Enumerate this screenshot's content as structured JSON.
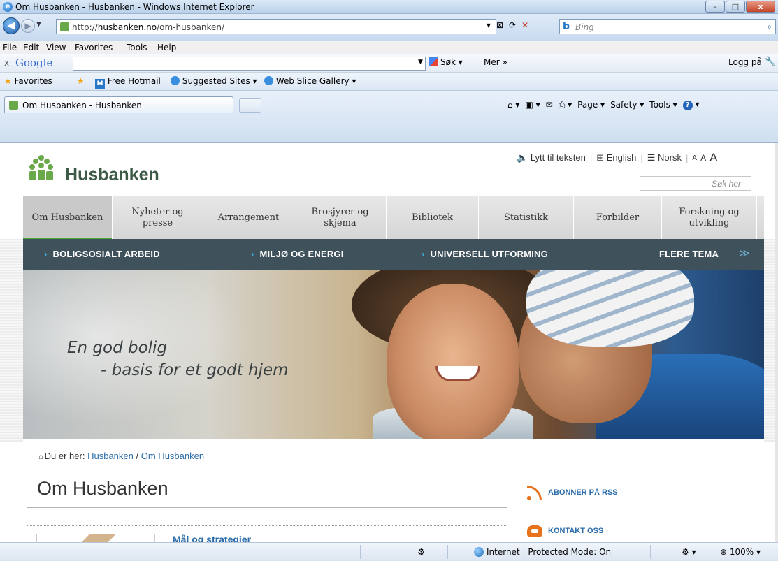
{
  "window": {
    "title": "Om Husbanken - Husbanken - Windows Internet Explorer",
    "minimize": "–",
    "maximize": "□",
    "close": "x"
  },
  "address": {
    "url_prefix": "http://",
    "url_host": "husbanken.no",
    "url_path": "/om-husbanken/",
    "search_placeholder": "Bing",
    "bing_logo": "b"
  },
  "menu": [
    "File",
    "Edit",
    "View",
    "Favorites",
    "Tools",
    "Help"
  ],
  "google_toolbar": {
    "close": "x",
    "logo": "Google",
    "search_button": "Søk",
    "more": "Mer »",
    "login": "Logg på"
  },
  "favorites_bar": {
    "favorites": "Favorites",
    "item1": "Free Hotmail",
    "item2": "Suggested Sites ▾",
    "item3": "Web Slice Gallery ▾"
  },
  "tab": {
    "title": "Om Husbanken - Husbanken"
  },
  "command_bar": {
    "page": "Page ▾",
    "safety": "Safety ▾",
    "tools": "Tools ▾"
  },
  "site": {
    "logo_text": "Husbanken",
    "util_listen": "Lytt til teksten",
    "util_english": "English",
    "util_norsk": "Norsk",
    "font_small": "A",
    "font_medium": "A",
    "font_large": "A",
    "search_placeholder": "Søk her",
    "nav": [
      {
        "label": "Om Husbanken",
        "active": true
      },
      {
        "label": "Nyheter og presse"
      },
      {
        "label": "Arrangement"
      },
      {
        "label": "Brosjyrer og skjema"
      },
      {
        "label": "Bibliotek"
      },
      {
        "label": "Statistikk"
      },
      {
        "label": "Forbilder"
      },
      {
        "label": "Forskning og utvikling"
      }
    ],
    "themes": [
      "BOLIGSOSIALT ARBEID",
      "MILJØ OG ENERGI",
      "UNIVERSELL UTFORMING",
      "FLERE TEMA"
    ],
    "hero_line1": "En god bolig",
    "hero_line2": "- basis for et godt hjem",
    "breadcrumb_prefix": "Du er her:",
    "breadcrumb_1": "Husbanken",
    "breadcrumb_sep": "/",
    "breadcrumb_2": "Om Husbanken",
    "page_title": "Om Husbanken",
    "article_link": "Mål og strategier",
    "rss_label": "ABONNER PÅ RSS",
    "contact_label": "KONTAKT OSS"
  },
  "status": {
    "zone": "Internet | Protected Mode: On",
    "zoom": "100%"
  },
  "colors": {
    "nav_active_underline": "#4aa832",
    "theme_bar": "#3f525c",
    "link": "#2a6ba8",
    "accent_orange": "#e8711c"
  }
}
